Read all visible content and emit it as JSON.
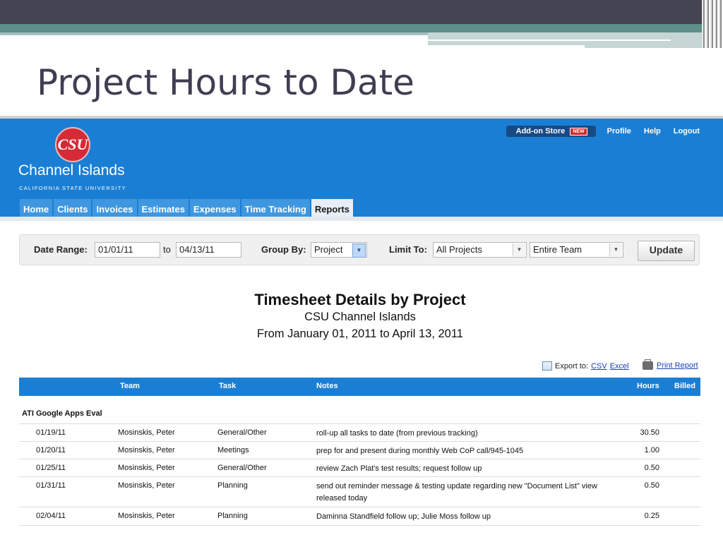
{
  "slide": {
    "title": "Project Hours to Date"
  },
  "header": {
    "logo_initials": "CSU",
    "logo_name": "Channel Islands",
    "logo_sub": "CALIFORNIA STATE UNIVERSITY",
    "addon_store": "Add-on Store",
    "new_badge": "NEW",
    "links": [
      "Profile",
      "Help",
      "Logout"
    ]
  },
  "nav": {
    "tabs": [
      "Home",
      "Clients",
      "Invoices",
      "Estimates",
      "Expenses",
      "Time Tracking",
      "Reports"
    ],
    "active": "Reports"
  },
  "filters": {
    "date_range_label": "Date Range:",
    "from": "01/01/11",
    "to_label": "to",
    "to": "04/13/11",
    "group_by_label": "Group By:",
    "group_by": "Project",
    "limit_to_label": "Limit To:",
    "limit_projects": "All Projects",
    "limit_team": "Entire Team",
    "update_label": "Update"
  },
  "report": {
    "title": "Timesheet Details by Project",
    "subtitle": "CSU Channel Islands",
    "range": "From January 01, 2011 to April 13, 2011",
    "export_label": "Export to:",
    "export_csv": "CSV",
    "export_excel": "Excel",
    "print_label": "Print Report"
  },
  "table": {
    "headers": {
      "team": "Team",
      "task": "Task",
      "notes": "Notes",
      "hours": "Hours",
      "billed": "Billed"
    },
    "group": "ATI Google Apps Eval",
    "rows": [
      {
        "date": "01/19/11",
        "team": "Mosinskis, Peter",
        "task": "General/Other",
        "notes": "roll-up all tasks to date (from previous tracking)",
        "hours": "30.50"
      },
      {
        "date": "01/20/11",
        "team": "Mosinskis, Peter",
        "task": "Meetings",
        "notes": "prep for and present during monthly Web CoP call/945-1045",
        "hours": "1.00"
      },
      {
        "date": "01/25/11",
        "team": "Mosinskis, Peter",
        "task": "General/Other",
        "notes": "review Zach Plat's test results; request follow up",
        "hours": "0.50"
      },
      {
        "date": "01/31/11",
        "team": "Mosinskis, Peter",
        "task": "Planning",
        "notes": "send out reminder message & testing update regarding new \"Document List\" view released today",
        "hours": "0.50"
      },
      {
        "date": "02/04/11",
        "team": "Mosinskis, Peter",
        "task": "Planning",
        "notes": "Daminna Standfield follow up; Julie Moss follow up",
        "hours": "0.25"
      }
    ]
  }
}
